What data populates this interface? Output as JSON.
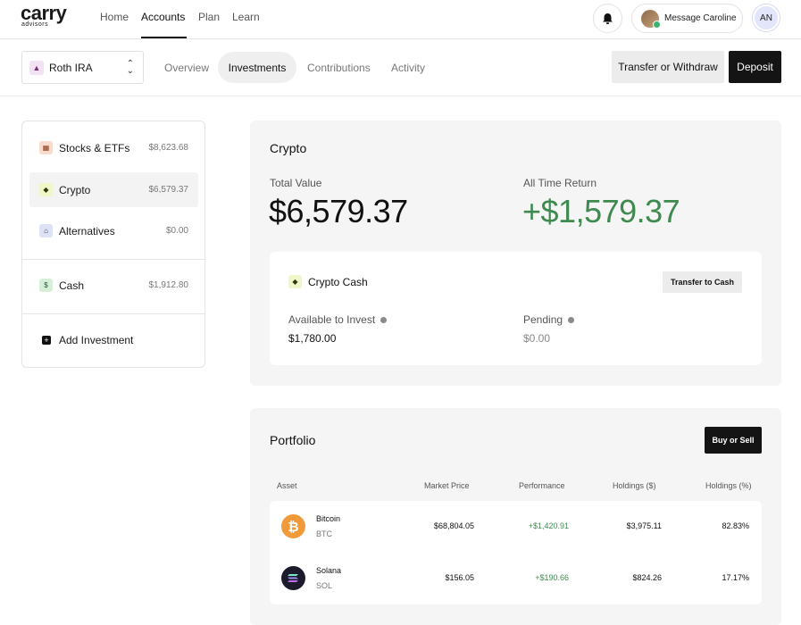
{
  "brand": {
    "name": "carry",
    "sub": "advisors"
  },
  "nav": {
    "home": "Home",
    "accounts": "Accounts",
    "plan": "Plan",
    "learn": "Learn"
  },
  "header": {
    "message_label": "Message Caroline",
    "user_initials": "AN"
  },
  "account": {
    "name": "Roth IRA"
  },
  "tabs": {
    "overview": "Overview",
    "investments": "Investments",
    "contributions": "Contributions",
    "activity": "Activity"
  },
  "actions": {
    "transfer": "Transfer or Withdraw",
    "deposit": "Deposit"
  },
  "sidebar": {
    "items": [
      {
        "label": "Stocks & ETFs",
        "value": "$8,623.68"
      },
      {
        "label": "Crypto",
        "value": "$6,579.37"
      },
      {
        "label": "Alternatives",
        "value": "$0.00"
      },
      {
        "label": "Cash",
        "value": "$1,912.80"
      },
      {
        "label": "Add Investment",
        "value": ""
      }
    ]
  },
  "crypto": {
    "title": "Crypto",
    "total_value_label": "Total Value",
    "total_value": "$6,579.37",
    "return_label": "All Time Return",
    "return_value": "+$1,579.37",
    "cash": {
      "title": "Crypto Cash",
      "transfer_label": "Transfer to Cash",
      "available_label": "Available to Invest",
      "available_value": "$1,780.00",
      "pending_label": "Pending",
      "pending_value": "$0.00"
    }
  },
  "portfolio": {
    "title": "Portfolio",
    "buy_sell_label": "Buy or Sell",
    "columns": [
      "Asset",
      "Market Price",
      "Performance",
      "Holdings ($)",
      "Holdings (%)"
    ],
    "rows": [
      {
        "name": "Bitcoin",
        "symbol": "BTC",
        "price": "$68,804.05",
        "performance": "+$1,420.91",
        "holdings_usd": "$3,975.11",
        "holdings_pct": "82.83%"
      },
      {
        "name": "Solana",
        "symbol": "SOL",
        "price": "$156.05",
        "performance": "+$190.66",
        "holdings_usd": "$824.26",
        "holdings_pct": "17.17%"
      }
    ]
  },
  "colors": {
    "positive": "#3f8a4f",
    "dark": "#141414",
    "bitcoin": "#f09a3a",
    "solana": "#1b1b2b"
  }
}
